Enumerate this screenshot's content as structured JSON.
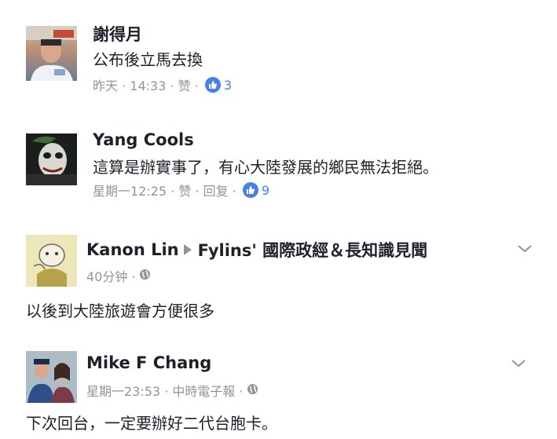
{
  "comments": [
    {
      "author": "謝得月",
      "text": "公布後立馬去換",
      "time": "昨天 · 14:33 · 赞 ·",
      "likes": "3"
    },
    {
      "author": "Yang Cools",
      "text": "這算是辦實事了，有心大陸發展的鄉民無法拒絕。",
      "time": "星期一12:25 · 赞 · 回复 ·",
      "likes": "9"
    },
    {
      "author": "Kanon Lin",
      "target": "Fylins' 國際政經＆長知識見聞",
      "time": "40分钟 ·",
      "text": "以後到大陸旅遊會方便很多"
    },
    {
      "author": "Mike F Chang",
      "time": "星期一23:53 · 中時電子報 ·",
      "text": "下次回台，一定要辦好二代台胞卡。"
    }
  ],
  "colors": {
    "accent": "#4a7fe4",
    "meta": "#90949c",
    "text": "#1d2129"
  }
}
